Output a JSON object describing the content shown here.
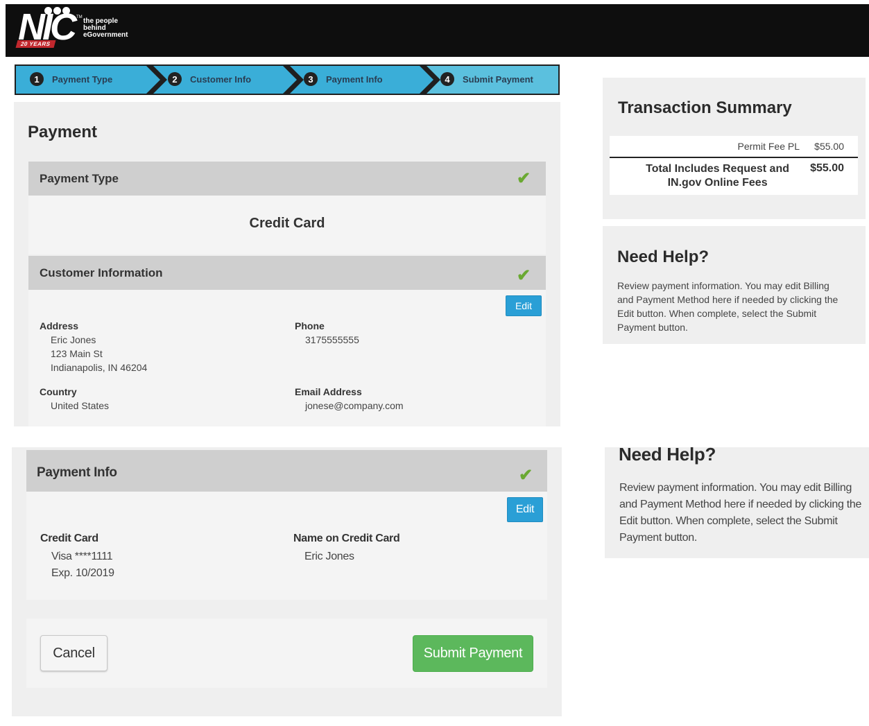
{
  "header": {
    "logo_text": "NIC",
    "tagline_1": "the people",
    "tagline_2": "behind",
    "tagline_3": "eGovernment",
    "years_badge": "20 YEARS"
  },
  "steps": [
    {
      "num": "1",
      "label": "Payment Type"
    },
    {
      "num": "2",
      "label": "Customer Info"
    },
    {
      "num": "3",
      "label": "Payment Info"
    },
    {
      "num": "4",
      "label": "Submit Payment"
    }
  ],
  "colors": {
    "step_fill": "#3aaed8",
    "step_active": "#5bc0de",
    "check": "#6aa932",
    "edit": "#2a9fd6",
    "submit": "#5cb85c"
  },
  "payment": {
    "title": "Payment",
    "payment_type": {
      "title": "Payment Type",
      "value": "Credit Card"
    },
    "customer_info": {
      "title": "Customer Information",
      "edit_label": "Edit",
      "address_label": "Address",
      "address_lines": [
        "Eric Jones",
        "123 Main St",
        "Indianapolis, IN 46204"
      ],
      "phone_label": "Phone",
      "phone": "3175555555",
      "country_label": "Country",
      "country": "United States",
      "email_label": "Email Address",
      "email": "jonese@company.com"
    }
  },
  "summary": {
    "title": "Transaction Summary",
    "item_label": "Permit Fee PL",
    "item_amount": "$55.00",
    "total_label_1": "Total Includes Request and",
    "total_label_2": "IN.gov Online Fees",
    "total_amount": "$55.00"
  },
  "help": {
    "title": "Need Help?",
    "lines": [
      "Review payment information. You may edit Billing",
      "and Payment Method here if needed by clicking the",
      "Edit button. When complete, select the Submit",
      "Payment button."
    ]
  },
  "payment_info": {
    "title": "Payment Info",
    "edit_label": "Edit",
    "card_label": "Credit Card",
    "card_number": "Visa ****1111",
    "card_exp": "Exp. 10/2019",
    "name_label": "Name on Credit Card",
    "name": "Eric Jones"
  },
  "actions": {
    "cancel_label": "Cancel",
    "submit_label": "Submit Payment"
  }
}
